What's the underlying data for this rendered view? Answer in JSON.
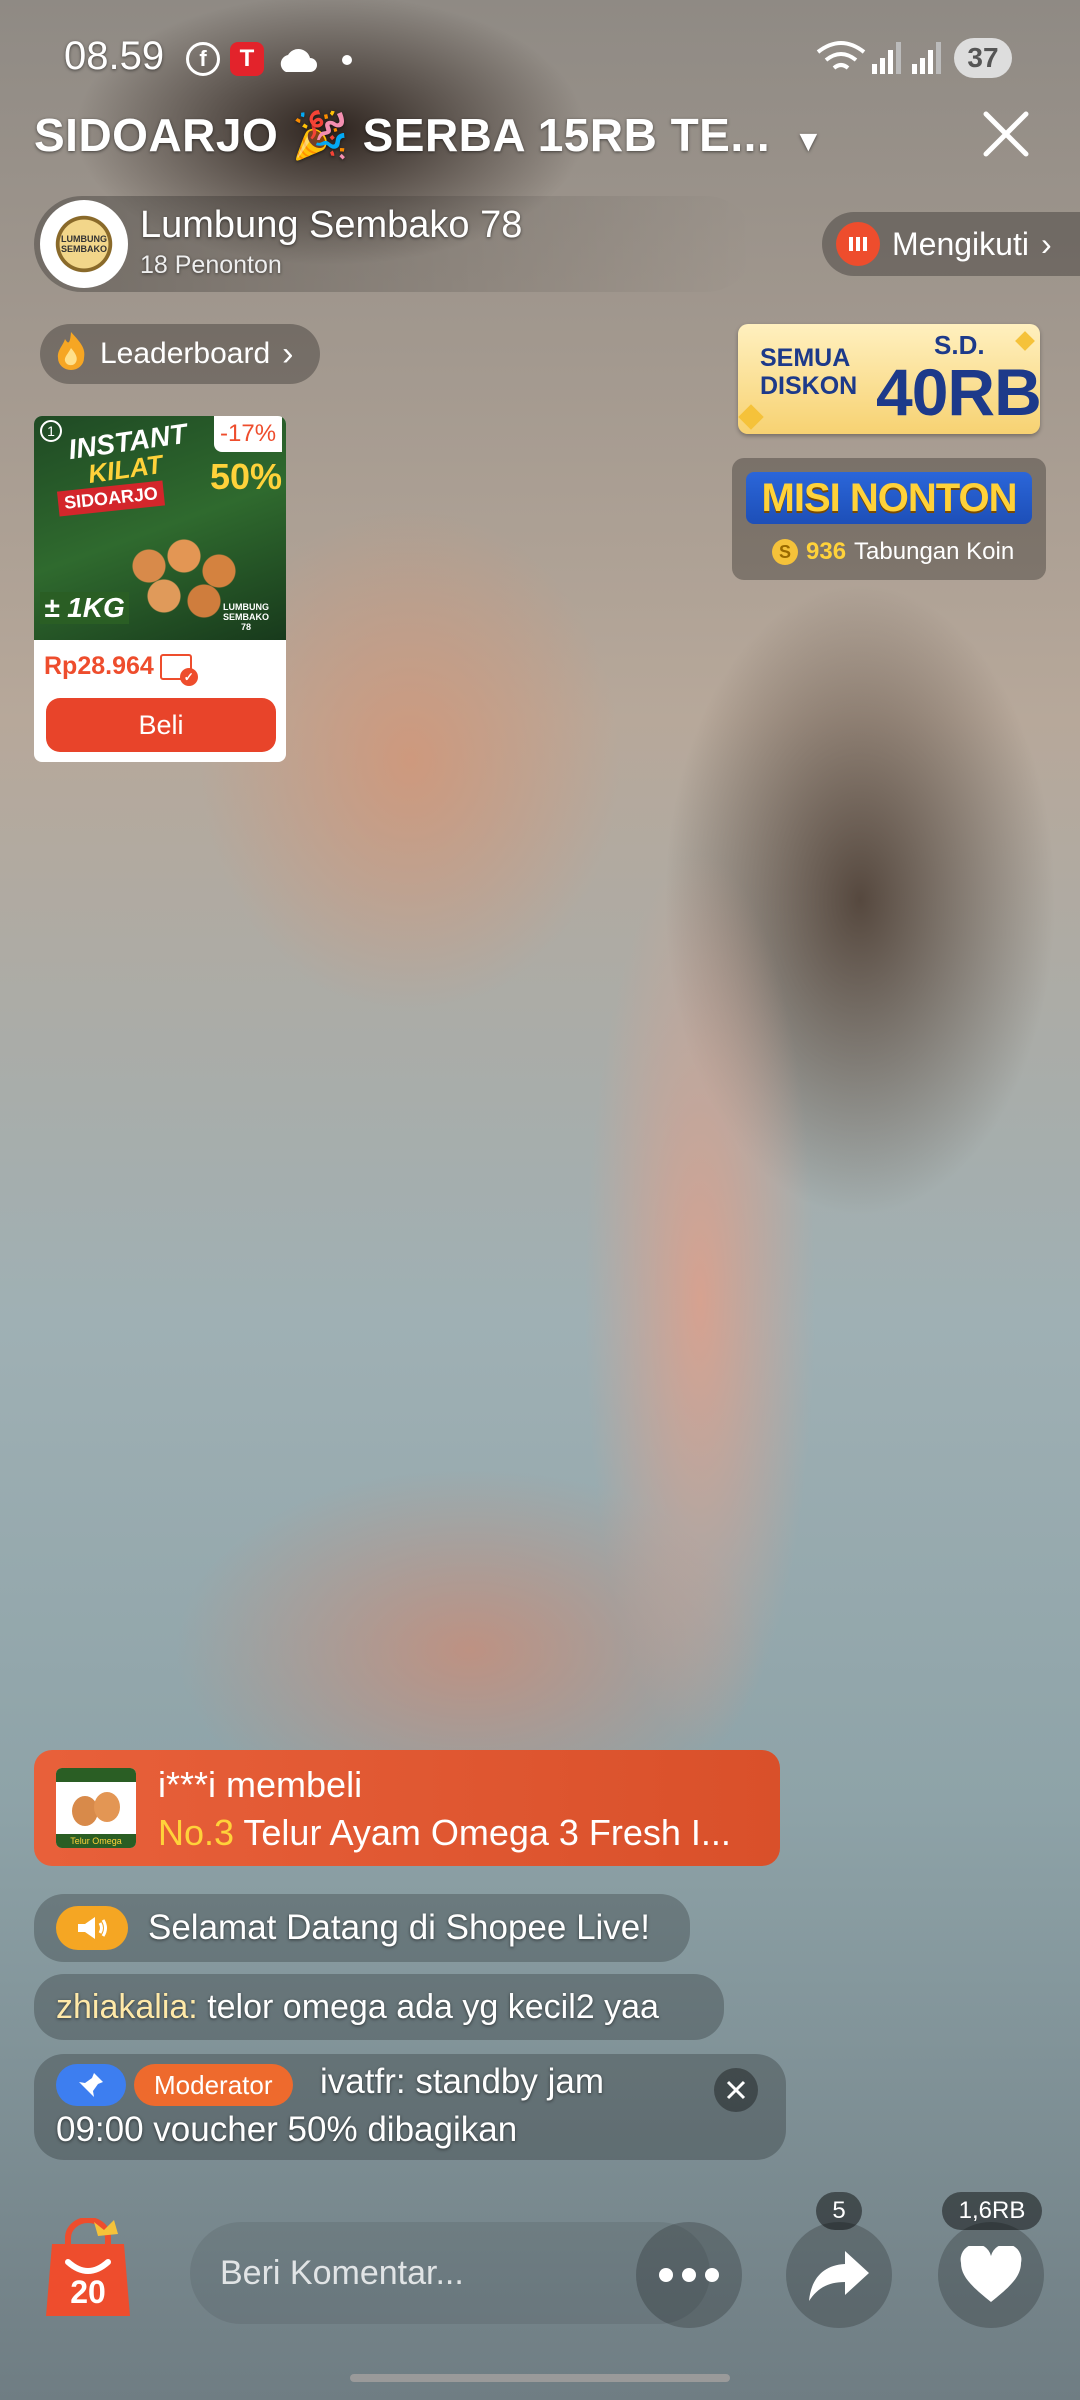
{
  "status_bar": {
    "time": "08.59",
    "battery": "37",
    "icons": [
      "facebook-icon",
      "telkomsel-icon",
      "cloud-icon",
      "dot-icon",
      "wifi-icon",
      "signal-icon"
    ]
  },
  "header": {
    "title": "SIDOARJO 🎉 SERBA 15RB TE...",
    "title_arrow": "▼"
  },
  "streamer": {
    "name": "Lumbung Sembako 78",
    "viewers": "18 Penonton",
    "avatar_text": "LUMBUNG SEMBAKO",
    "follow_label": "Mengikuti",
    "follow_arrow": "›"
  },
  "leaderboard": {
    "label": "Leaderboard",
    "arrow": "›"
  },
  "discount_banner": {
    "line1": "SEMUA",
    "line2": "DISKON",
    "prefix": "S.D.",
    "amount": "40RB"
  },
  "mission": {
    "title": "MISI NONTON",
    "coins": "936",
    "coins_label": "Tabungan Koin"
  },
  "product": {
    "discount": "-17%",
    "img_line1": "INSTANT",
    "img_line2": "KILAT",
    "img_city": "SIDOARJO",
    "img_sale": "50%",
    "img_weight": "± 1KG",
    "img_brand": "LUMBUNG SEMBAKO 78",
    "price": "Rp28.964",
    "buy_label": "Beli"
  },
  "purchase_toast": {
    "buyer": "i***i membeli",
    "rank": "No.3",
    "item": "Telur Ayam Omega 3 Fresh I...",
    "thumb_label": "Telur Omega"
  },
  "chat": {
    "welcome": "Selamat Datang di Shopee Live!",
    "comment_user": "zhiakalia:",
    "comment_text": "telor omega ada yg kecil2 yaa",
    "pinned_badge": "Moderator",
    "pinned_user": "ivatfr:",
    "pinned_text_1": "standby jam",
    "pinned_text_2": "09:00 voucher 50% dibagikan"
  },
  "bottom_bar": {
    "bag_count": "20",
    "comment_placeholder": "Beri Komentar...",
    "share_count": "5",
    "like_count": "1,6RB"
  },
  "colors": {
    "shopee_orange": "#ee4d2d",
    "gold": "#f5c23a",
    "mission_blue": "#1d4fb8"
  }
}
